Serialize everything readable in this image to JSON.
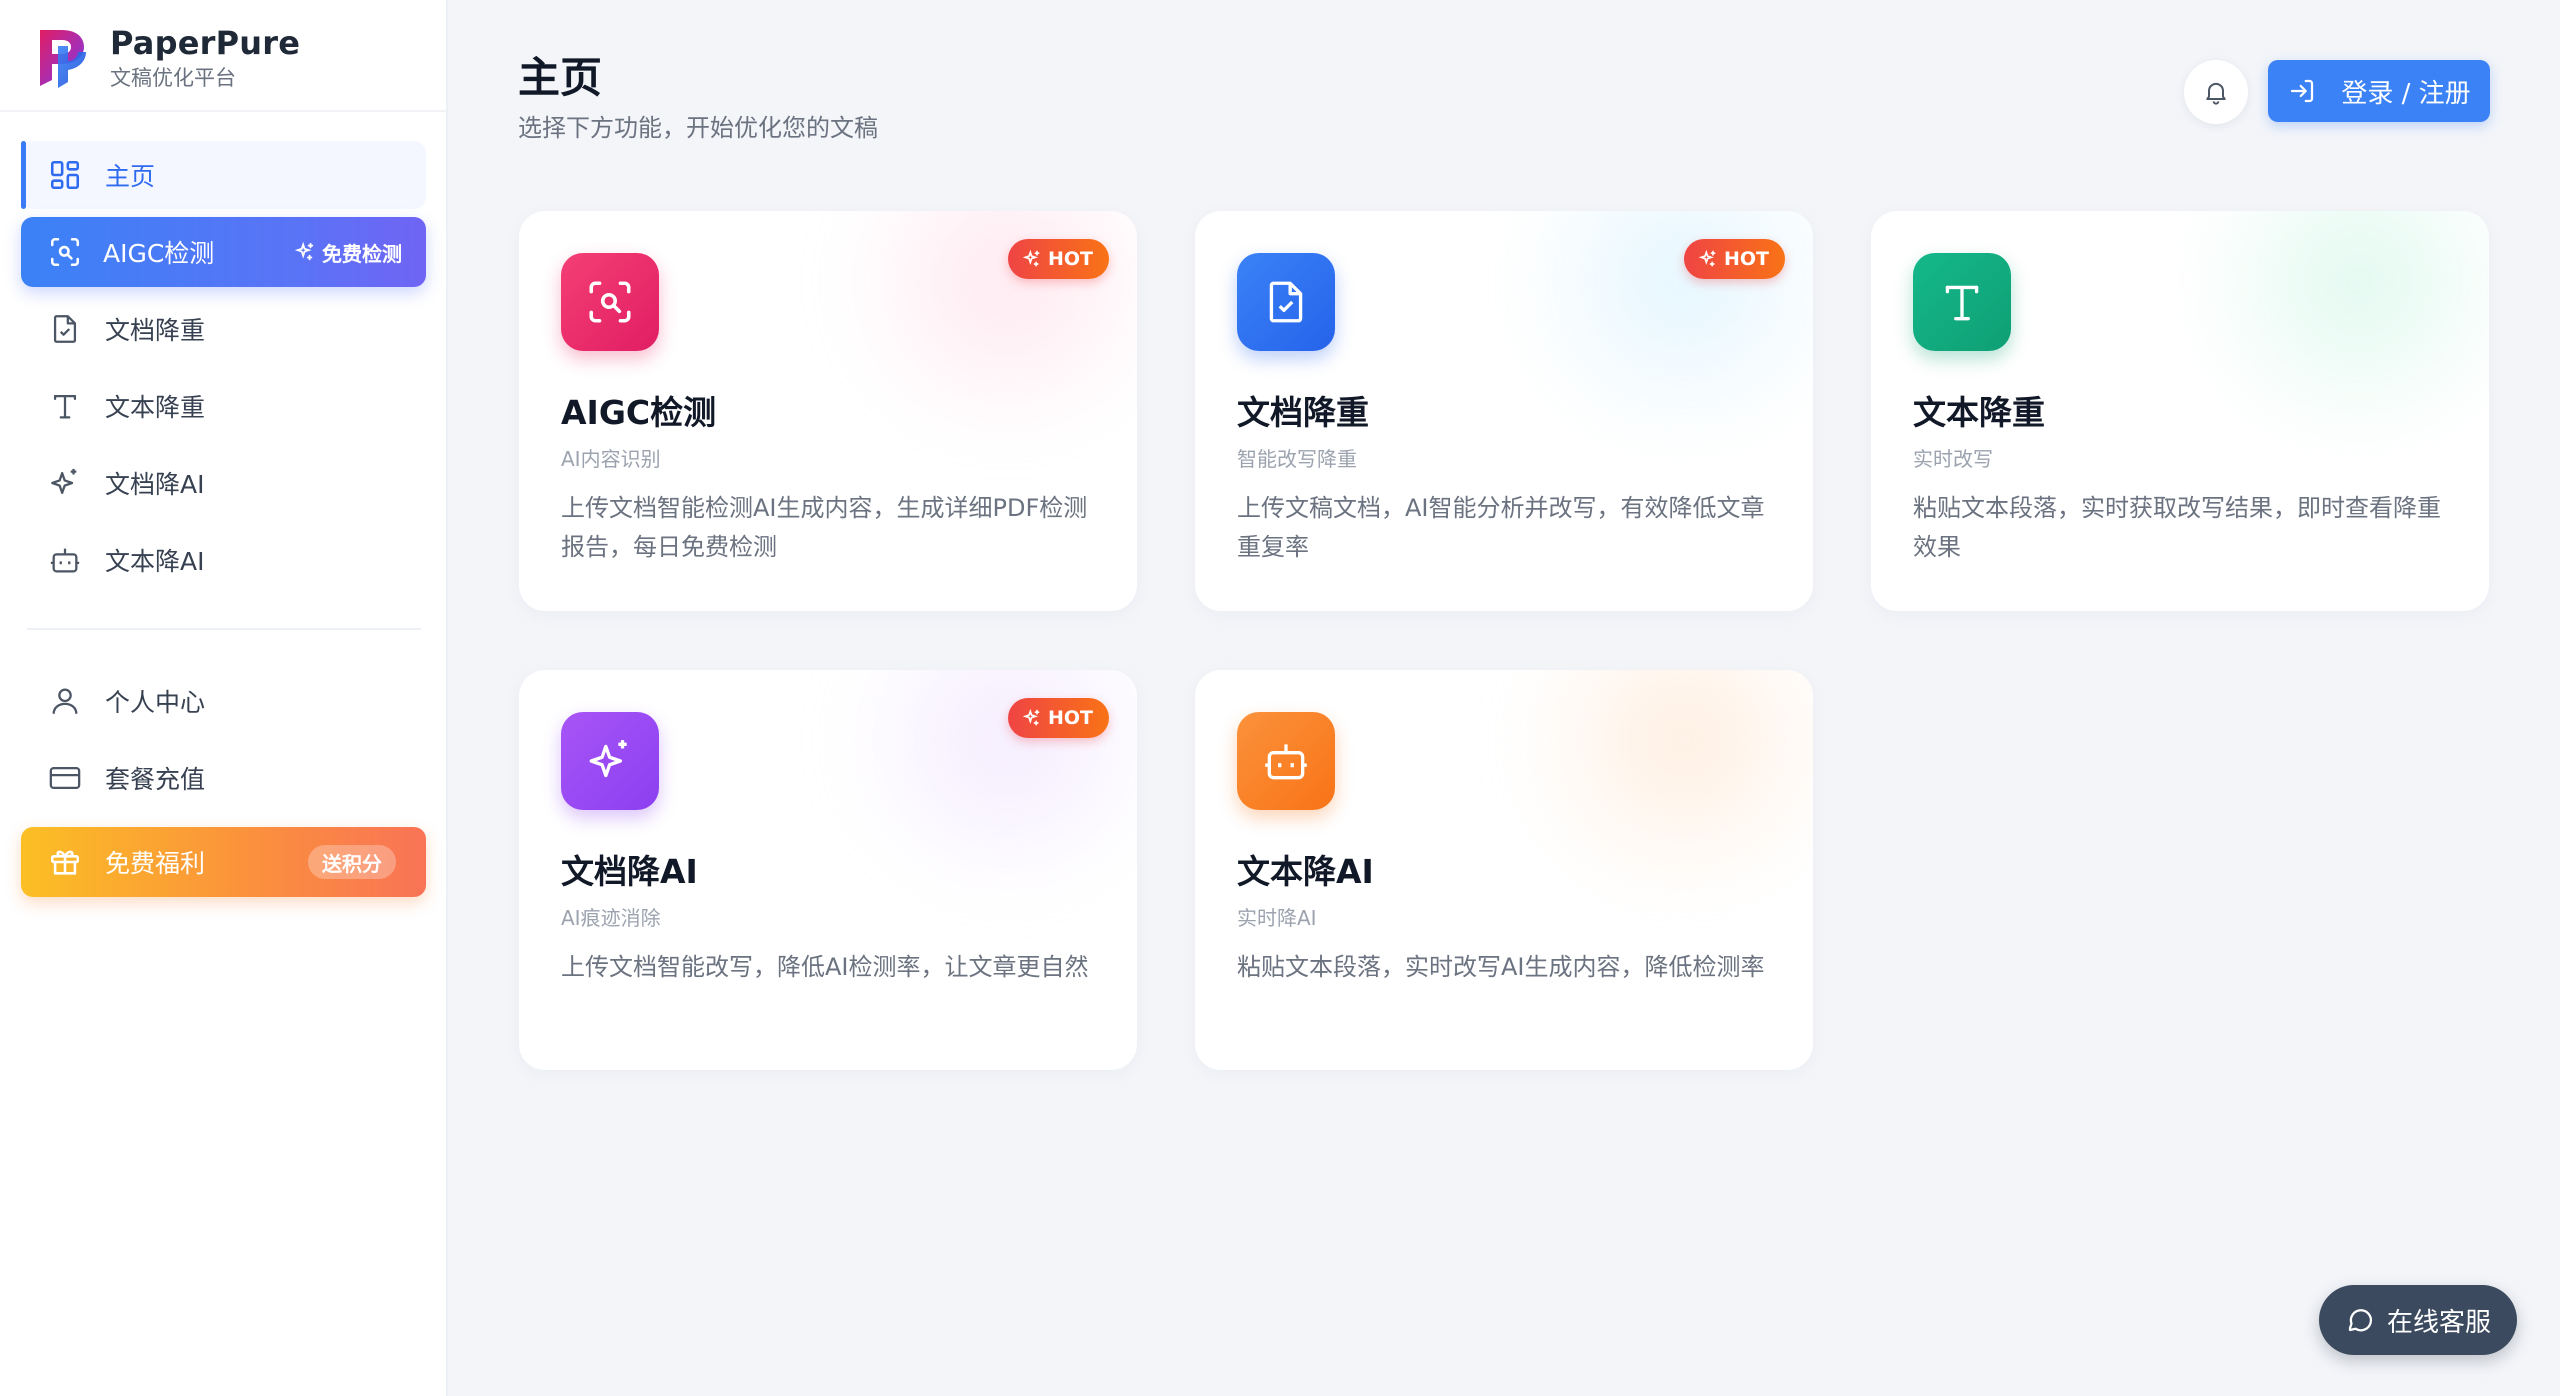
{
  "brand": {
    "name": "PaperPure",
    "subtitle": "文稿优化平台"
  },
  "sidebar": {
    "items": [
      {
        "label": "主页",
        "icon": "grid-icon",
        "active": true
      },
      {
        "label": "AIGC检测",
        "icon": "scan-search-icon",
        "badge": "免费检测"
      },
      {
        "label": "文档降重",
        "icon": "file-check-icon"
      },
      {
        "label": "文本降重",
        "icon": "text-icon"
      },
      {
        "label": "文档降AI",
        "icon": "sparkles-icon"
      },
      {
        "label": "文本降AI",
        "icon": "bot-icon"
      },
      {
        "label": "个人中心",
        "icon": "user-icon"
      },
      {
        "label": "套餐充值",
        "icon": "credit-card-icon"
      },
      {
        "label": "免费福利",
        "icon": "gift-icon",
        "badge": "送积分"
      }
    ]
  },
  "header": {
    "title": "主页",
    "subtitle": "选择下方功能，开始优化您的文稿",
    "login_label": "登录 / 注册"
  },
  "cards": [
    {
      "title": "AIGC检测",
      "tag": "AI内容识别",
      "desc": "上传文档智能检测AI生成内容，生成详细PDF检测报告，每日免费检测",
      "hot": "HOT",
      "icon": "scan-search-icon",
      "color": "#f0306e"
    },
    {
      "title": "文档降重",
      "tag": "智能改写降重",
      "desc": "上传文稿文档，AI智能分析并改写，有效降低文章重复率",
      "hot": "HOT",
      "icon": "file-check-icon",
      "color": "#2f73f2"
    },
    {
      "title": "文本降重",
      "tag": "实时改写",
      "desc": "粘贴文本段落，实时获取改写结果，即时查看降重效果",
      "icon": "text-icon",
      "color": "#12ad80"
    },
    {
      "title": "文档降AI",
      "tag": "AI痕迹消除",
      "desc": "上传文档智能改写，降低AI检测率，让文章更自然",
      "hot": "HOT",
      "icon": "sparkles-icon",
      "color": "#9b4cf4"
    },
    {
      "title": "文本降AI",
      "tag": "实时降AI",
      "desc": "粘贴文本段落，实时改写AI生成内容，降低检测率",
      "icon": "bot-icon",
      "color": "#fb7f26"
    }
  ],
  "support": {
    "label": "在线客服"
  }
}
